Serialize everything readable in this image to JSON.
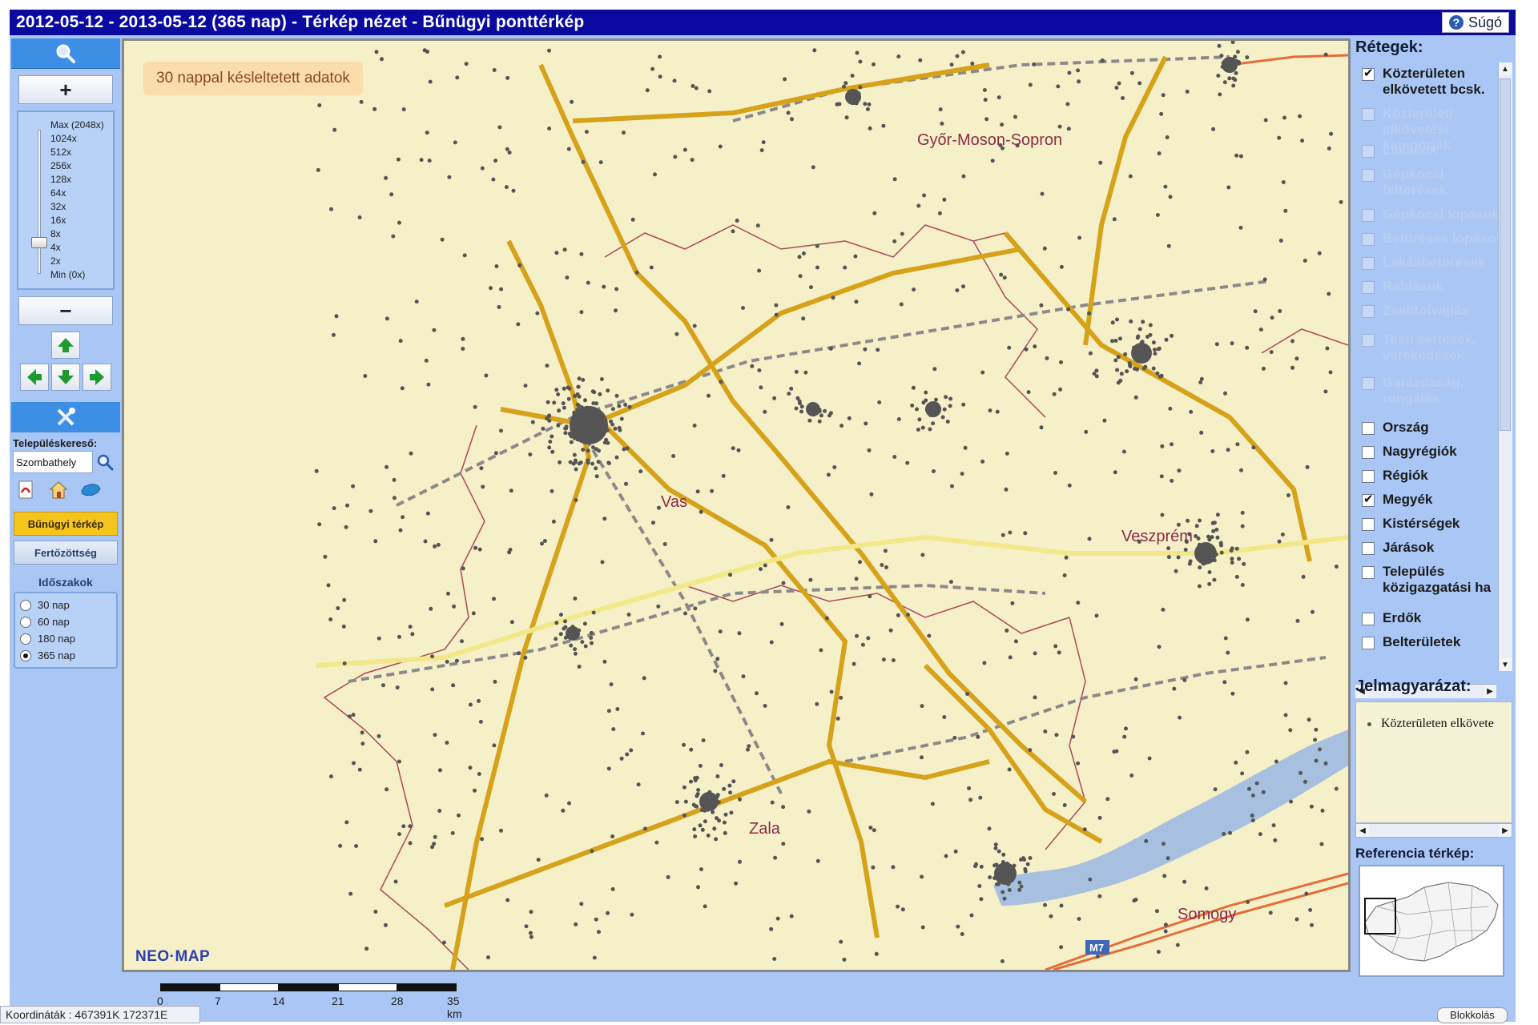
{
  "window": {
    "title": "2012-05-12 - 2013-05-12 (365 nap) - Térkép nézet - Bűnügyi ponttérkép",
    "help_label": "Súgó"
  },
  "left_panel": {
    "zoom_in_label": "+",
    "zoom_out_label": "−",
    "zoom_levels": [
      "Max (2048x)",
      "1024x",
      "512x",
      "256x",
      "128x",
      "64x",
      "32x",
      "16x",
      "8x",
      "4x",
      "2x",
      "Min (0x)"
    ],
    "zoom_level_selected": "4x",
    "search_label": "Településkereső:",
    "search_value": "Szombathely",
    "mode_buttons": [
      {
        "label": "Bűnügyi térkép",
        "active": true
      },
      {
        "label": "Fertőzöttség",
        "active": false
      }
    ],
    "periods_title": "Időszakok",
    "periods": [
      {
        "label": "30 nap",
        "selected": false
      },
      {
        "label": "60 nap",
        "selected": false
      },
      {
        "label": "180 nap",
        "selected": false
      },
      {
        "label": "365 nap",
        "selected": true
      }
    ]
  },
  "map": {
    "notice": "30 nappal késleltetett adatok",
    "brand": "NEO·MAP",
    "labels": [
      "Győr-Moson-Sopron",
      "Vas",
      "Veszprém",
      "Zala",
      "Somogy"
    ],
    "road_sign": "M7",
    "colors": {
      "background": "#f6f0c8",
      "lake": "#a8c0e0",
      "main_road": "#d6a21a",
      "secondary_road": "#f2e88a",
      "rail": "#8a8a8a",
      "county_border": "#a84a5a",
      "crime_point": "#555555"
    }
  },
  "right_panel": {
    "layers_title": "Rétegek:",
    "layers": [
      {
        "label": "Közterületen elkövetett bcsk.",
        "checked": true,
        "enabled": true
      },
      {
        "label": "Közterületi elkövetési kategóriák",
        "checked": false,
        "enabled": false
      },
      {
        "label": "Lakások",
        "checked": false,
        "enabled": false
      },
      {
        "label": "Gépkocsi feltörések",
        "checked": false,
        "enabled": false
      },
      {
        "label": "Gépkocsi lopások",
        "checked": false,
        "enabled": false
      },
      {
        "label": "Betöréses lopások",
        "checked": false,
        "enabled": false
      },
      {
        "label": "Lakásbetörések",
        "checked": false,
        "enabled": false
      },
      {
        "label": "Rablások",
        "checked": false,
        "enabled": false
      },
      {
        "label": "Zsebtolvajlás",
        "checked": false,
        "enabled": false
      },
      {
        "label": "Testi sértések, verekedések",
        "checked": false,
        "enabled": false
      },
      {
        "label": "Garázdaság, rongálás",
        "checked": false,
        "enabled": false
      },
      {
        "label": "Ország",
        "checked": false,
        "enabled": true
      },
      {
        "label": "Nagyrégiók",
        "checked": false,
        "enabled": true
      },
      {
        "label": "Régiók",
        "checked": false,
        "enabled": true
      },
      {
        "label": "Megyék",
        "checked": true,
        "enabled": true
      },
      {
        "label": "Kistérségek",
        "checked": false,
        "enabled": true
      },
      {
        "label": "Járások",
        "checked": false,
        "enabled": true
      },
      {
        "label": "Település közigazgatási ha",
        "checked": false,
        "enabled": true
      },
      {
        "label": "Erdők",
        "checked": false,
        "enabled": true
      },
      {
        "label": "Belterületek",
        "checked": false,
        "enabled": true
      }
    ],
    "legend_title": "Jelmagyarázat:",
    "legend_entry": "Közterületen elkövete",
    "reference_title": "Referencia térkép:"
  },
  "scale": {
    "ticks": [
      "0",
      "7",
      "14",
      "21",
      "28",
      "35 km"
    ]
  },
  "status": {
    "coords": "Koordináták : 467391K   172371E",
    "blocking_label": "Blokkolás"
  }
}
